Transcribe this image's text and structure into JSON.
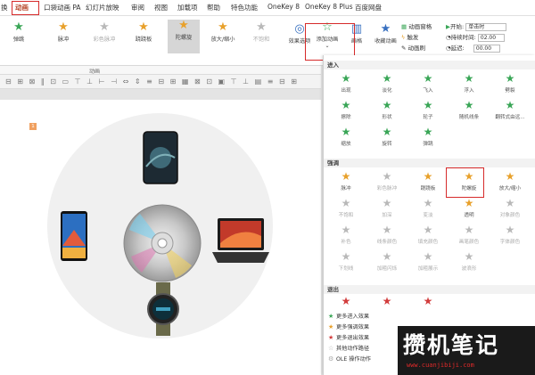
{
  "menu": {
    "tabs": [
      "换",
      "动画",
      "口袋动画 PA",
      "幻灯片放映",
      "审阅",
      "视图",
      "加载项",
      "帮助",
      "特色功能",
      "OneKey 8",
      "OneKey 8 Plus",
      "百度网盘"
    ]
  },
  "ribbon": {
    "effects": [
      "弹跳",
      "脉冲",
      "彩色脉冲",
      "跷跷板",
      "陀螺旋",
      "放大/缩小",
      "不饱和"
    ],
    "effect_options": "效果选项",
    "add_animation": "添加动画",
    "animation_pane_short": "画格",
    "advanced_animation": "高级动画",
    "custom_path": "收藏动画",
    "animation_pane": "动画窗格",
    "trigger": "触发",
    "painter": "动画刷",
    "group_label": "动画",
    "start_label": "开始:",
    "start_value": "单击时",
    "duration_label": "持续时间:",
    "duration_value": "02.00",
    "delay_label": "延迟:",
    "delay_value": "00.00"
  },
  "panel": {
    "sections": {
      "entrance": "进入",
      "emphasis": "强调",
      "exit": "退出"
    },
    "entrance_effects": [
      "出现",
      "淡化",
      "飞入",
      "浮入",
      "劈裂",
      "擦除",
      "形状",
      "轮子",
      "随机线条",
      "翻转式由远...",
      "缩放",
      "旋转",
      "弹跳"
    ],
    "emphasis_effects": [
      "脉冲",
      "彩色脉冲",
      "跷跷板",
      "陀螺旋",
      "放大/缩小",
      "不饱和",
      "加深",
      "变淡",
      "透明",
      "对象颜色",
      "补色",
      "线条颜色",
      "填充颜色",
      "画笔颜色",
      "字体颜色",
      "下划线",
      "加粗闪烁",
      "加粗展示",
      "波浪形"
    ],
    "more_items": [
      "更多进入效果",
      "更多强调效果",
      "更多退出效果",
      "其他动作路径",
      "OLE 操作动作"
    ]
  },
  "watermark": {
    "title": "攒机笔记",
    "url": "www.cuanjibiji.com"
  },
  "slide": {
    "number": "1"
  }
}
